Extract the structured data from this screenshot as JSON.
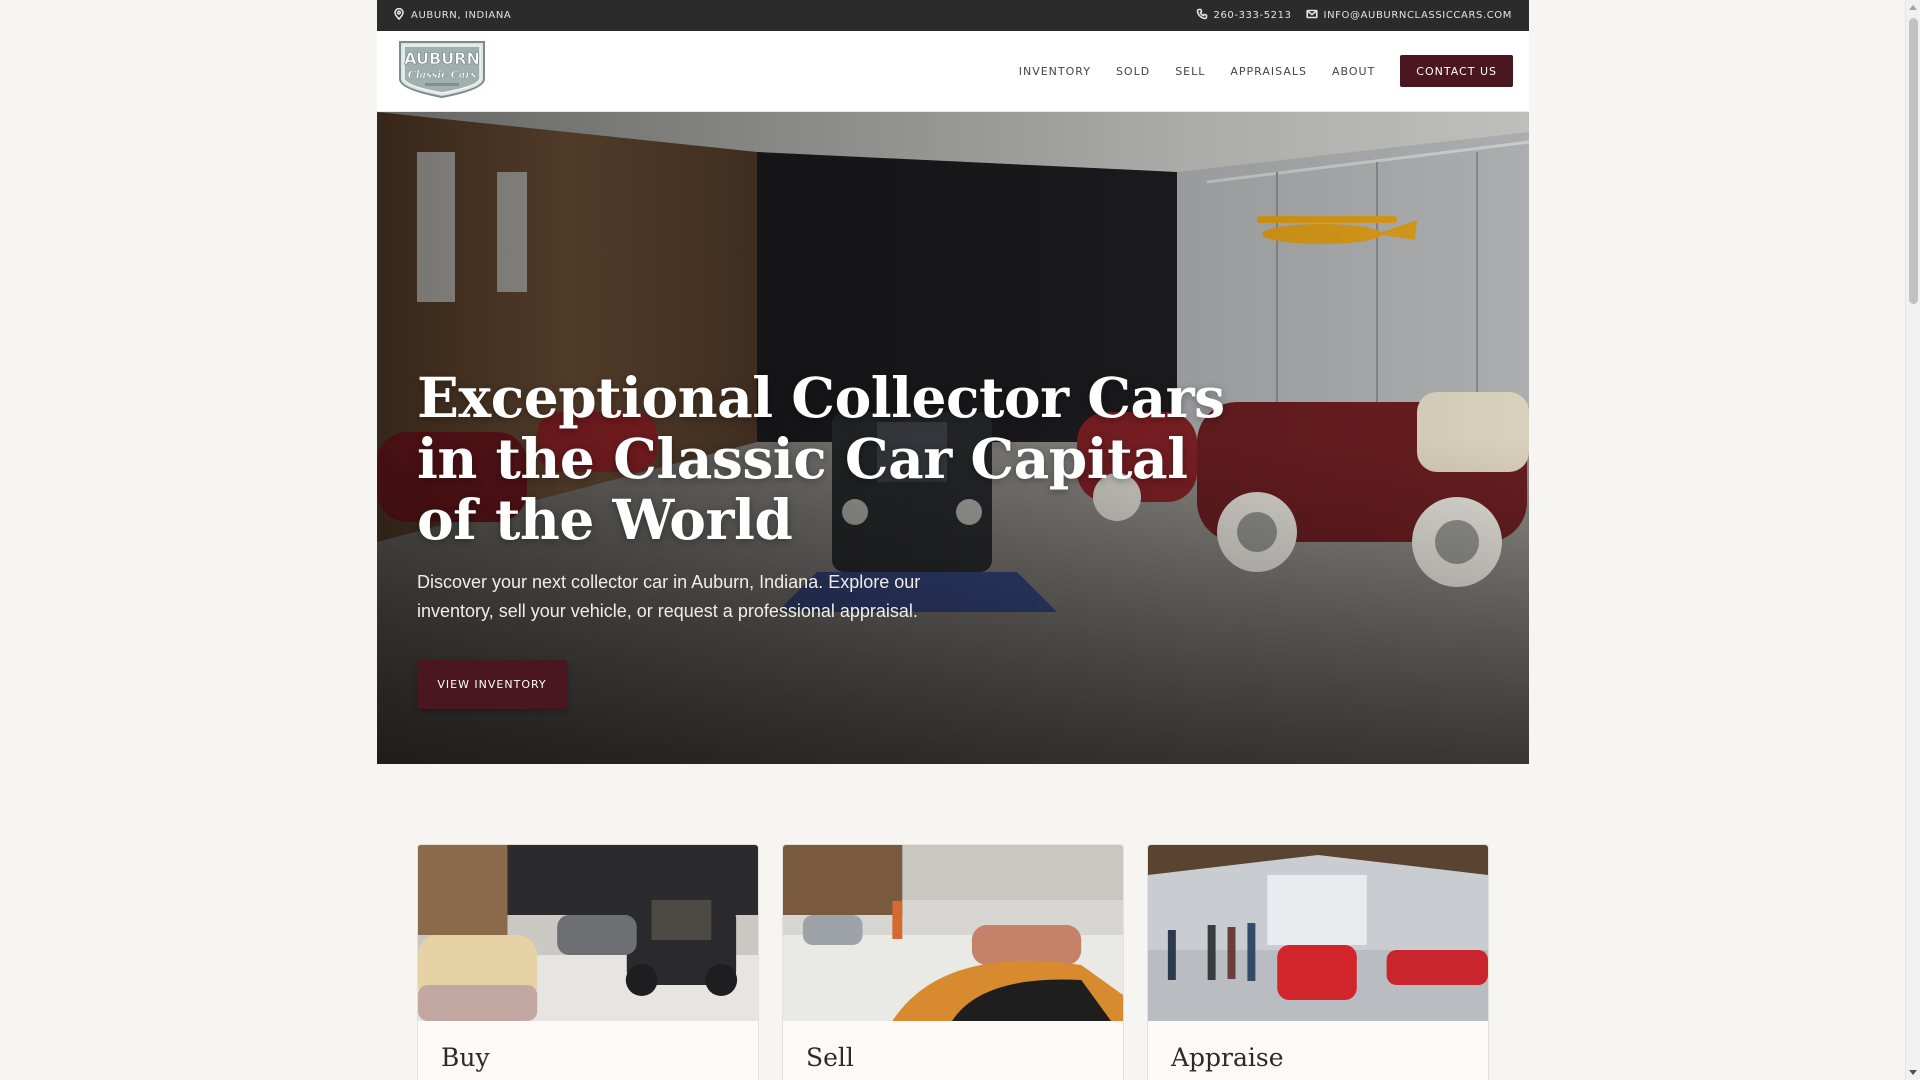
{
  "topbar": {
    "location": "AUBURN, INDIANA",
    "phone": "260-333-5213",
    "email": "INFO@AUBURNCLASSICCARS.COM"
  },
  "logo": {
    "line1": "AUBURN",
    "line2": "Classic Cars"
  },
  "nav": {
    "items": [
      "INVENTORY",
      "SOLD",
      "SELL",
      "APPRAISALS",
      "ABOUT"
    ],
    "cta": "CONTACT US"
  },
  "hero": {
    "title": "Exceptional Collector Cars in the Classic Car Capital of the World",
    "subtitle": "Discover your next collector car in Auburn, Indiana. Explore our inventory, sell your vehicle, or request a professional appraisal.",
    "button": "VIEW INVENTORY"
  },
  "cards": [
    {
      "title": "Buy"
    },
    {
      "title": "Sell"
    },
    {
      "title": "Appraise"
    }
  ],
  "colors": {
    "accent": "#4a1620",
    "topbar": "#2b2b2b",
    "background": "#f7f5f1"
  }
}
